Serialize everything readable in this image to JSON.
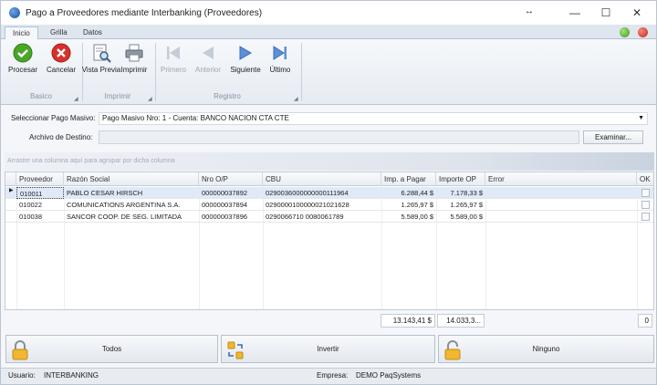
{
  "window": {
    "title": "Pago a Proveedores mediante Interbanking (Proveedores)",
    "resize_glyph": "↔",
    "minimize": "—",
    "maximize": "☐",
    "close": "✕"
  },
  "ribbon_tabs": [
    "Inicio",
    "Grilla",
    "Datos"
  ],
  "groups": {
    "basico": {
      "label": "Basico",
      "buttons": [
        {
          "label": "Procesar",
          "icon": "check-icon"
        },
        {
          "label": "Cancelar",
          "icon": "cancel-icon"
        }
      ]
    },
    "imprimir": {
      "label": "Imprimir",
      "buttons": [
        {
          "label": "Vista Previa",
          "icon": "preview-icon"
        },
        {
          "label": "Imprimir",
          "icon": "printer-icon"
        }
      ]
    },
    "registro": {
      "label": "Registro",
      "buttons": [
        {
          "label": "Primero",
          "icon": "first-icon"
        },
        {
          "label": "Anterior",
          "icon": "previous-icon"
        },
        {
          "label": "Siguiente",
          "icon": "next-icon"
        },
        {
          "label": "Último",
          "icon": "last-icon"
        }
      ]
    }
  },
  "form": {
    "pago_label": "Seleccionar Pago Masivo:",
    "pago_value": "Pago Masivo Nro: 1 - Cuenta: BANCO NACION CTA CTE",
    "archivo_label": "Archivo de Destino:",
    "archivo_value": "",
    "examinar": "Examinar..."
  },
  "group_hint": "Arrastre una columna aquí para agrupar por dicha columna",
  "grid": {
    "columns": [
      "Proveedor",
      "Razón Social",
      "Nro O/P",
      "CBU",
      "Imp. a Pagar",
      "Importe OP",
      "Error",
      "OK"
    ],
    "rows": [
      {
        "proveedor": "010011",
        "razon": "PABLO CESAR HIRSCH",
        "nro": "000000037892",
        "cbu": "0290036000000000111964",
        "imp": "6.288,44 $",
        "importe": "7.178,33 $",
        "error": "",
        "ok": false,
        "selected": true
      },
      {
        "proveedor": "010022",
        "razon": "COMUNICATIONS ARGENTINA S.A.",
        "nro": "000000037894",
        "cbu": "0290000100000021021628",
        "imp": "1.265,97 $",
        "importe": "1.265,97 $",
        "error": "",
        "ok": false,
        "selected": false
      },
      {
        "proveedor": "010038",
        "razon": "SANCOR COOP. DE SEG. LIMITADA",
        "nro": "000000037896",
        "cbu": "0290066710  0080061789",
        "imp": "5.589,00 $",
        "importe": "5.589,00 $",
        "error": "",
        "ok": false,
        "selected": false
      }
    ],
    "totals": {
      "imp": "13.143,41 $",
      "importe": "14.033,3...",
      "ok_count": "0"
    }
  },
  "actions": {
    "todos": "Todos",
    "invertir": "Invertir",
    "ninguno": "Ninguno"
  },
  "status": {
    "usuario_label": "Usuario:",
    "usuario": "INTERBANKING",
    "empresa_label": "Empresa:",
    "empresa": "DEMO PaqSystems"
  },
  "colors": {
    "ok_green": "#3f9a1f",
    "cancel_red": "#d6322c",
    "selection": "#dfe9f7"
  }
}
